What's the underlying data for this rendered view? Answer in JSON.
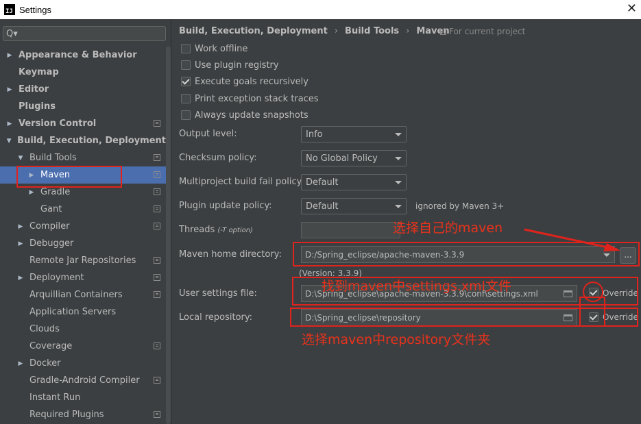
{
  "window": {
    "title": "Settings",
    "app_icon_text": "IJ"
  },
  "sidebar": {
    "search_placeholder": "Q▾",
    "items": [
      {
        "label": "Appearance & Behavior",
        "arrow": "▶",
        "indent": 0,
        "bold": true,
        "copy": false
      },
      {
        "label": "Keymap",
        "arrow": "",
        "indent": 0,
        "bold": true,
        "copy": false
      },
      {
        "label": "Editor",
        "arrow": "▶",
        "indent": 0,
        "bold": true,
        "copy": false
      },
      {
        "label": "Plugins",
        "arrow": "",
        "indent": 0,
        "bold": true,
        "copy": false
      },
      {
        "label": "Version Control",
        "arrow": "▶",
        "indent": 0,
        "bold": true,
        "copy": true
      },
      {
        "label": "Build, Execution, Deployment",
        "arrow": "▼",
        "indent": 0,
        "bold": true,
        "copy": false
      },
      {
        "label": "Build Tools",
        "arrow": "▼",
        "indent": 1,
        "bold": false,
        "copy": true
      },
      {
        "label": "Maven",
        "arrow": "▶",
        "indent": 2,
        "bold": false,
        "copy": true,
        "selected": true
      },
      {
        "label": "Gradle",
        "arrow": "▶",
        "indent": 2,
        "bold": false,
        "copy": true
      },
      {
        "label": "Gant",
        "arrow": "",
        "indent": 2,
        "bold": false,
        "copy": true
      },
      {
        "label": "Compiler",
        "arrow": "▶",
        "indent": 1,
        "bold": false,
        "copy": true
      },
      {
        "label": "Debugger",
        "arrow": "▶",
        "indent": 1,
        "bold": false,
        "copy": false
      },
      {
        "label": "Remote Jar Repositories",
        "arrow": "",
        "indent": 1,
        "bold": false,
        "copy": true
      },
      {
        "label": "Deployment",
        "arrow": "▶",
        "indent": 1,
        "bold": false,
        "copy": true
      },
      {
        "label": "Arquillian Containers",
        "arrow": "",
        "indent": 1,
        "bold": false,
        "copy": true
      },
      {
        "label": "Application Servers",
        "arrow": "",
        "indent": 1,
        "bold": false,
        "copy": false
      },
      {
        "label": "Clouds",
        "arrow": "",
        "indent": 1,
        "bold": false,
        "copy": false
      },
      {
        "label": "Coverage",
        "arrow": "",
        "indent": 1,
        "bold": false,
        "copy": true
      },
      {
        "label": "Docker",
        "arrow": "▶",
        "indent": 1,
        "bold": false,
        "copy": false
      },
      {
        "label": "Gradle-Android Compiler",
        "arrow": "",
        "indent": 1,
        "bold": false,
        "copy": true
      },
      {
        "label": "Instant Run",
        "arrow": "",
        "indent": 1,
        "bold": false,
        "copy": false
      },
      {
        "label": "Required Plugins",
        "arrow": "",
        "indent": 1,
        "bold": false,
        "copy": true
      }
    ]
  },
  "breadcrumb": {
    "part1": "Build, Execution, Deployment",
    "sep": "›",
    "part2": "Build Tools",
    "part3": "Maven",
    "scope": "For current project"
  },
  "checkboxes": [
    {
      "label": "Work offline",
      "checked": false
    },
    {
      "label": "Use plugin registry",
      "checked": false
    },
    {
      "label": "Execute goals recursively",
      "checked": true
    },
    {
      "label": "Print exception stack traces",
      "checked": false
    },
    {
      "label": "Always update snapshots",
      "checked": false
    }
  ],
  "fields": {
    "output_level": {
      "label": "Output level:",
      "value": "Info"
    },
    "checksum_policy": {
      "label": "Checksum policy:",
      "value": "No Global Policy"
    },
    "multiproject": {
      "label": "Multiproject build fail policy:",
      "value": "Default"
    },
    "plugin_update": {
      "label": "Plugin update policy:",
      "value": "Default",
      "note": "ignored by Maven 3+"
    },
    "threads": {
      "label": "Threads",
      "hint": "(-T option)"
    },
    "maven_home": {
      "label": "Maven home directory:",
      "value": "D:/Spring_eclipse/apache-maven-3.3.9",
      "version": "(Version: 3.3.9)",
      "browse": "..."
    },
    "user_settings": {
      "label": "User settings file:",
      "value": "D:\\Spring_eclipse\\apache-maven-3.3.9\\conf\\settings.xml",
      "override": "Override",
      "override_checked": true
    },
    "local_repo": {
      "label": "Local repository:",
      "value": "D:\\Spring_eclipse\\repository",
      "override": "Override",
      "override_checked": true
    }
  },
  "annotations": {
    "note1": "选择自己的maven",
    "note2": "找到maven中settings.xml文件",
    "note3": "选择maven中repository文件夹",
    "color": "#e0231c"
  }
}
